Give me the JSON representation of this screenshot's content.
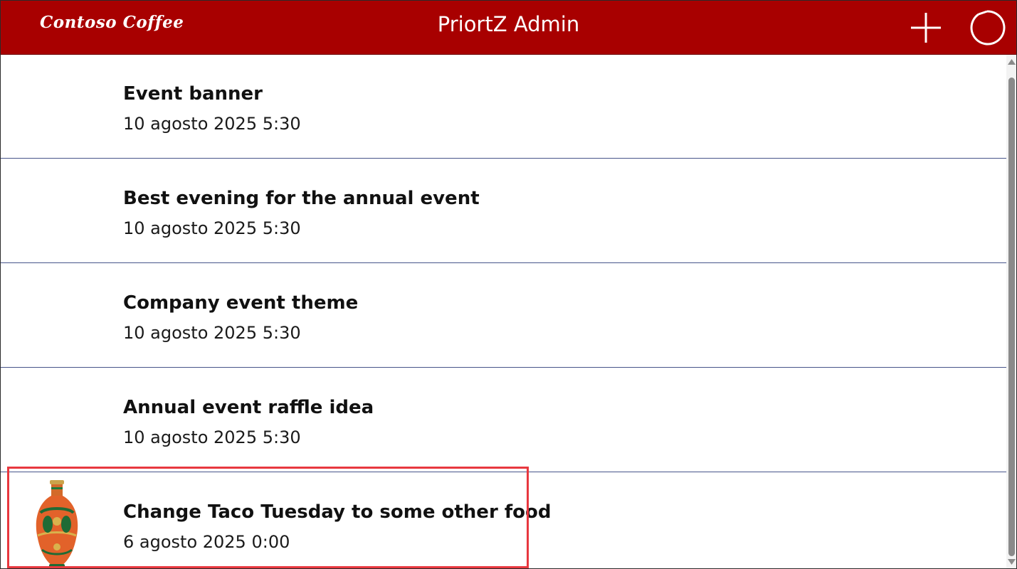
{
  "header": {
    "logo_text": "Contoso Coffee",
    "title": "PriortZ Admin",
    "add_icon": "plus-icon",
    "refresh_icon": "refresh-icon",
    "background_color": "#a80000"
  },
  "list": {
    "items": [
      {
        "title": "Event banner",
        "date": "10 agosto 2025 5:30",
        "has_image": false
      },
      {
        "title": "Best evening for the annual event",
        "date": "10 agosto 2025 5:30",
        "has_image": false
      },
      {
        "title": "Company event theme",
        "date": "10 agosto 2025 5:30",
        "has_image": false
      },
      {
        "title": "Annual event raffle idea",
        "date": "10 agosto 2025 5:30",
        "has_image": false
      },
      {
        "title": "Change Taco Tuesday to some other food",
        "date": "6 agosto 2025 0:00",
        "has_image": true,
        "image_icon": "vase-image",
        "highlighted": true
      }
    ]
  },
  "colors": {
    "divider": "#47548a",
    "highlight": "#e8383f"
  }
}
